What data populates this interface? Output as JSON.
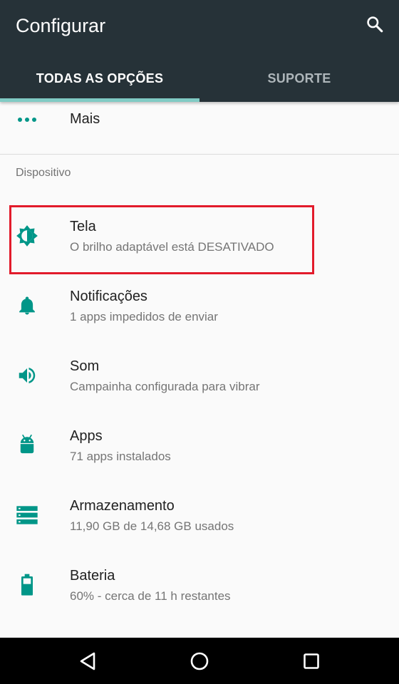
{
  "app_bar": {
    "title": "Configurar",
    "search_icon": "search-icon",
    "background": "#263238"
  },
  "tabs": [
    {
      "label": "TODAS AS OPÇÕES",
      "selected": true
    },
    {
      "label": "SUPORTE",
      "selected": false
    }
  ],
  "accent_color": "#009688",
  "highlight_color": "#e21b2b",
  "more_item": {
    "label": "Mais",
    "icon": "more-horizontal-icon"
  },
  "section": {
    "title": "Dispositivo"
  },
  "items": [
    {
      "label": "Tela",
      "summary": "O brilho adaptável está DESATIVADO",
      "icon": "brightness-icon"
    },
    {
      "label": "Notificações",
      "summary": "1 apps impedidos de enviar",
      "icon": "bell-icon"
    },
    {
      "label": "Som",
      "summary": "Campainha configurada para vibrar",
      "icon": "volume-icon"
    },
    {
      "label": "Apps",
      "summary": "71 apps instalados",
      "icon": "android-icon"
    },
    {
      "label": "Armazenamento",
      "summary": "11,90 GB de 14,68 GB usados",
      "icon": "storage-icon"
    },
    {
      "label": "Bateria",
      "summary": "60% - cerca de 11 h restantes",
      "icon": "battery-icon"
    }
  ],
  "nav_bar": {
    "buttons": [
      "back-icon",
      "home-icon",
      "recents-icon"
    ]
  }
}
